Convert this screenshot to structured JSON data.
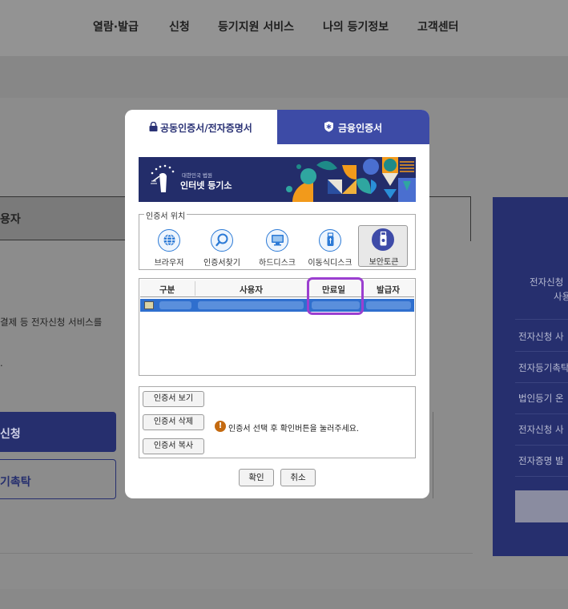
{
  "background": {
    "nav": [
      "열람·발급",
      "신청",
      "등기지원 서비스",
      "나의 등기정보",
      "고객센터"
    ],
    "left_header": "용자",
    "left_text1": "결제 등 전자신청 서비스를",
    "left_text2": ".",
    "left_button1": "신청",
    "left_button2": "기촉탁",
    "right_panel": {
      "intro_line1": "전자신청",
      "intro_line2": "사용",
      "items": [
        "전자신청 사",
        "전자등기촉탁",
        "법인등기 온",
        "전자신청 사",
        "전자증명 발"
      ]
    }
  },
  "modal": {
    "tabs": {
      "left": "공동인증서/전자증명서",
      "right": "금융인증서"
    },
    "banner": {
      "small": "대한민국 법원",
      "big": "인터넷 등기소"
    },
    "location": {
      "legend": "인증서 위치",
      "items": [
        "브라우저",
        "인증서찾기",
        "하드디스크",
        "이동식디스크",
        "보안토큰"
      ]
    },
    "table": {
      "headers": [
        "구분",
        "사용자",
        "만료일",
        "발급자"
      ]
    },
    "actions": {
      "view": "인증서 보기",
      "delete": "인증서 삭제",
      "copy": "인증서 복사"
    },
    "info": {
      "icon": "!",
      "text": "인증서 선택 후 확인버튼을 눌러주세요."
    },
    "buttons": {
      "ok": "확인",
      "cancel": "취소"
    }
  },
  "colors": {
    "accent": "#3d4ba6",
    "navy": "#232d6a",
    "selected_row": "#2f6fce",
    "highlight": "#9b3fd0",
    "warning": "#c46a10"
  }
}
